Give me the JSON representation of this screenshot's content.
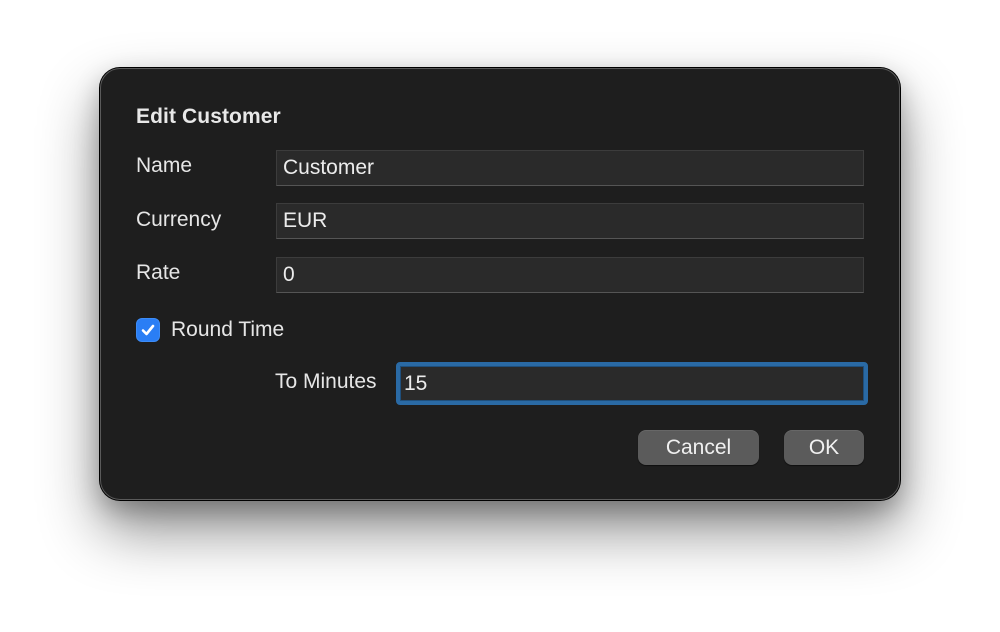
{
  "dialog": {
    "title": "Edit Customer",
    "fields": [
      {
        "label": "Name",
        "value": "Customer"
      },
      {
        "label": "Currency",
        "value": "EUR"
      },
      {
        "label": "Rate",
        "value": "0"
      }
    ],
    "round_time": {
      "label": "Round Time",
      "checked": true,
      "icon": "checkmark-icon"
    },
    "to_minutes": {
      "label": "To Minutes",
      "value": "15",
      "focused": true
    },
    "buttons": {
      "cancel_label": "Cancel",
      "ok_label": "OK"
    }
  },
  "colors": {
    "dialog_background": "#1e1e1e",
    "field_background": "#2a2a2a",
    "checkbox_accent": "#2a7ef5",
    "focus_ring": "#2a6aa5",
    "button_background": "#5b5b5b",
    "text": "#e6e6e6"
  }
}
